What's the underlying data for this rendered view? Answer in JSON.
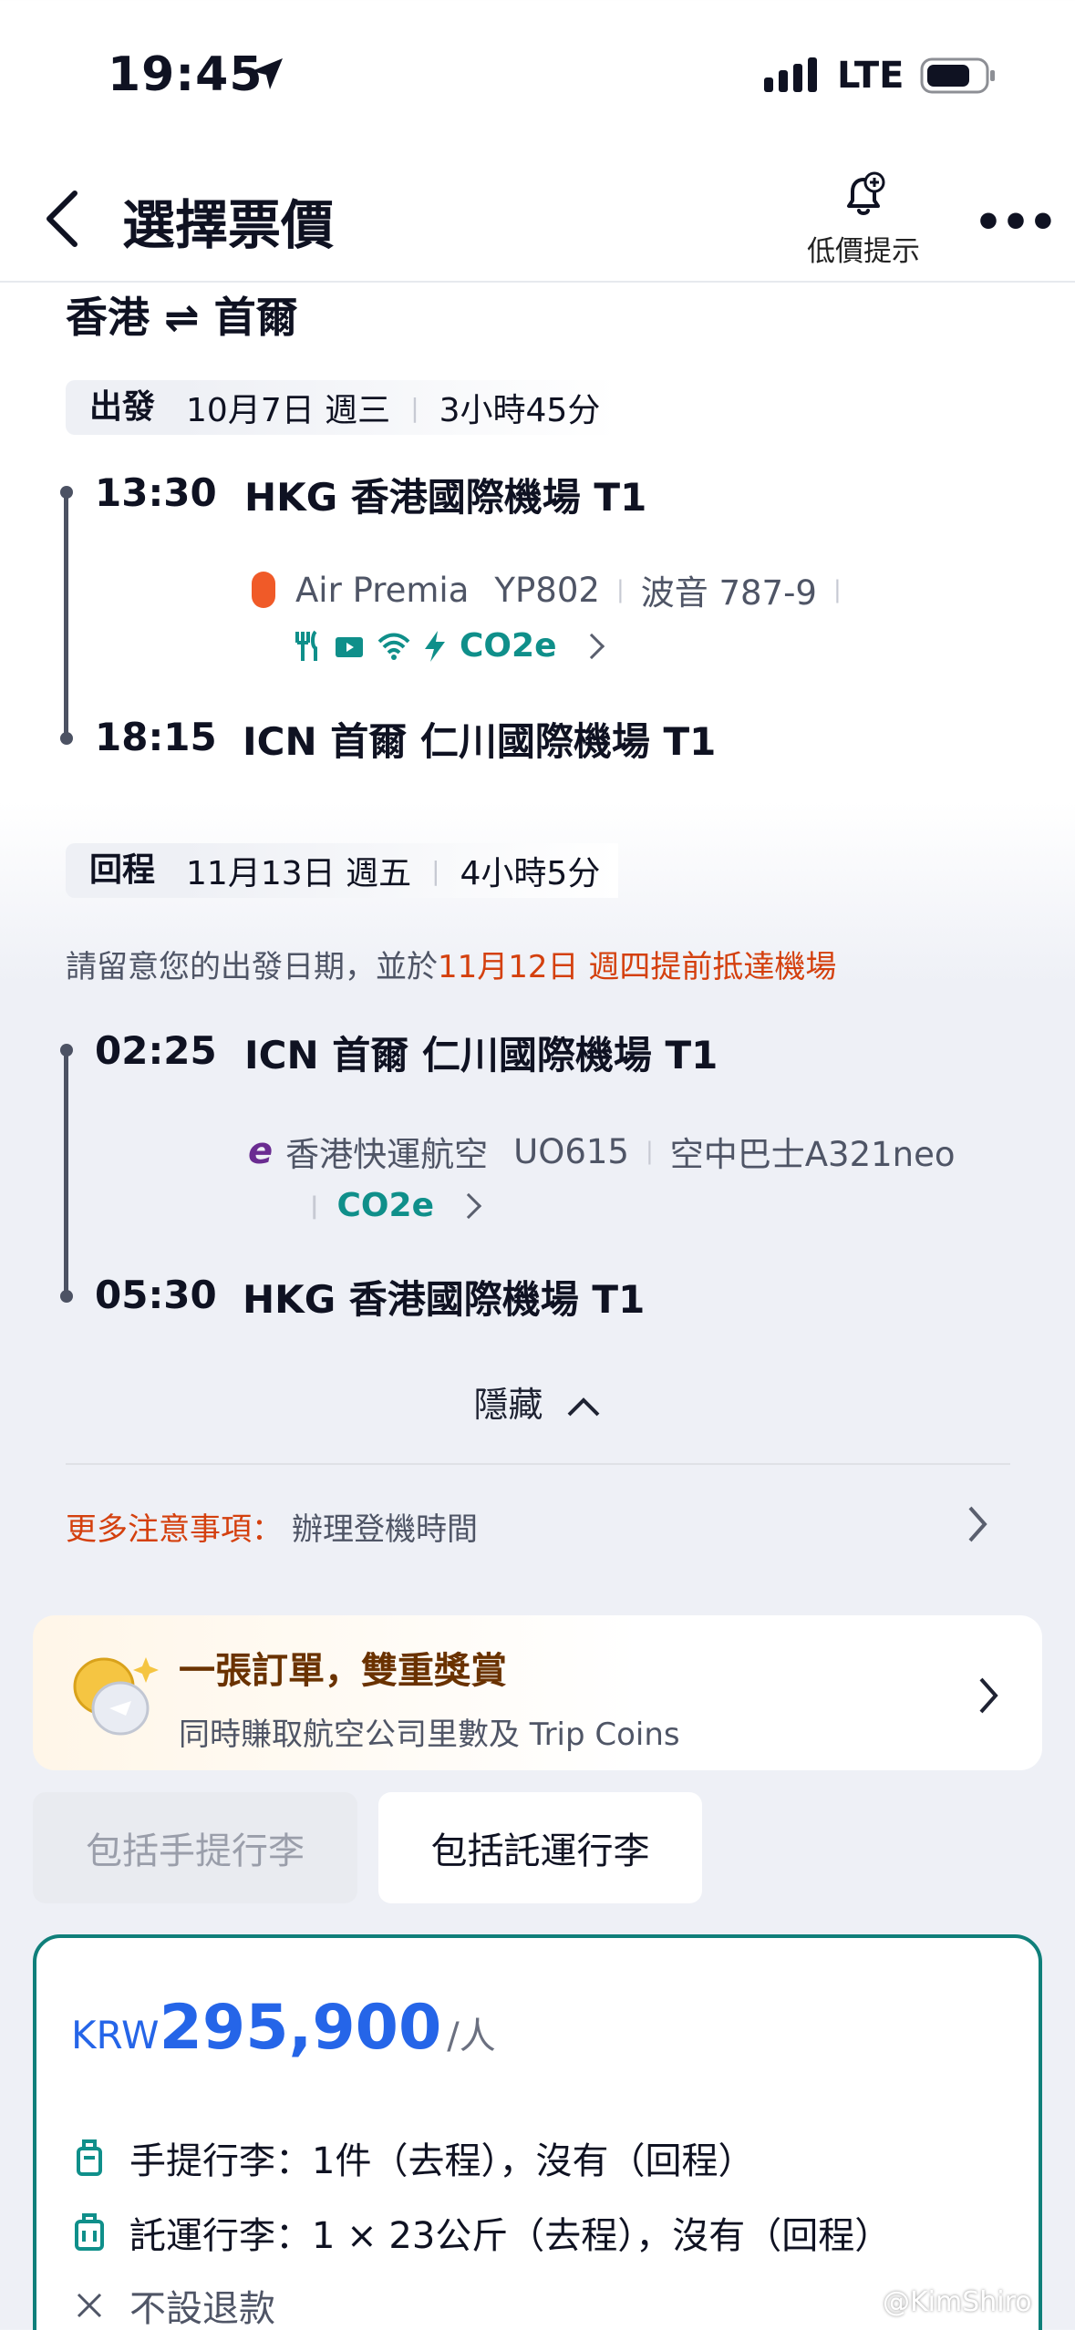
{
  "status_bar": {
    "time": "19:45",
    "network": "LTE"
  },
  "header": {
    "title": "選擇票價",
    "alert_label": "低價提示"
  },
  "route": "香港 ⇌ 首爾",
  "outbound": {
    "label": "出發",
    "date": "10月7日 週三",
    "duration": "3小時45分",
    "depart_time": "13:30",
    "depart_airport": "HKG 香港國際機場 T1",
    "airline": "Air Premia",
    "flight_no": "YP802",
    "aircraft": "波音 787-9",
    "co2": "CO2e",
    "arrive_time": "18:15",
    "arrive_airport": "ICN 首爾 仁川國際機場 T1"
  },
  "return": {
    "label": "回程",
    "date": "11月13日 週五",
    "duration": "4小時5分",
    "notice_prefix": "請留意您的出發日期，並於",
    "notice_highlight": "11月12日 週四提前抵達機場",
    "depart_time": "02:25",
    "depart_airport": "ICN 首爾 仁川國際機場 T1",
    "airline": "香港快運航空",
    "flight_no": "UO615",
    "aircraft": "空中巴士A321neo",
    "co2": "CO2e",
    "arrive_time": "05:30",
    "arrive_airport": "HKG 香港國際機場 T1"
  },
  "hide_label": "隱藏",
  "more_notes": {
    "label": "更多注意事項：",
    "value": "辦理登機時間"
  },
  "promo": {
    "title": "一張訂單，雙重獎賞",
    "subtitle": "同時賺取航空公司里數及 Trip Coins"
  },
  "tabs": [
    "包括手提行李",
    "包括託運行李"
  ],
  "fare": {
    "currency": "KRW",
    "amount": "295,900",
    "per": "/人",
    "carry_on": "手提行李：1件（去程），沒有（回程）",
    "checked": "託運行李：1 × 23公斤（去程），沒有（回程）",
    "refund": "不設退款"
  },
  "watermark": "@KimShiro",
  "colors": {
    "accent_teal": "#0f7f7a",
    "price_blue": "#2565e8",
    "warning_orange": "#d4400e"
  }
}
